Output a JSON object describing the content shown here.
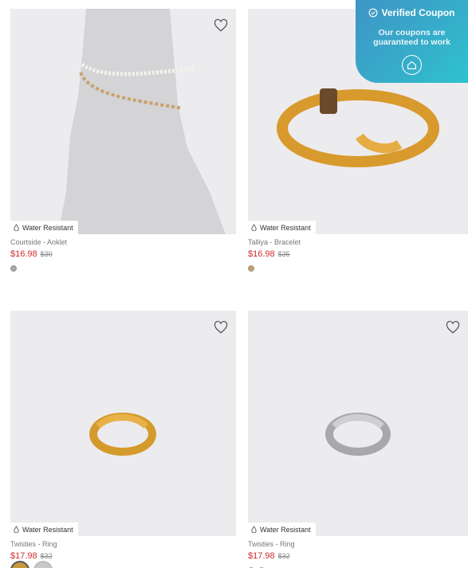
{
  "products": [
    {
      "badge": "Water Resistant",
      "title": "Courtside - Anklet",
      "price": "$16.98",
      "was": "$30",
      "swatches": [
        "#a6a6a6"
      ],
      "wishlist_icon": "heart-outline-icon"
    },
    {
      "badge": "Water Resistant",
      "title": "Talliya - Bracelet",
      "price": "$16.98",
      "was": "$35",
      "swatches": [
        "#c9a15a"
      ],
      "wishlist_icon": "heart-outline-icon"
    },
    {
      "badge": "Water Resistant",
      "title": "Twisties - Ring",
      "price": "$17.98",
      "was": "$32",
      "swatches": [
        "#c79a3e",
        "#c8c8c8"
      ],
      "wishlist_icon": "heart-outline-icon"
    },
    {
      "badge": "Water Resistant",
      "title": "Twisties - Ring",
      "price": "$17.98",
      "was": "$32",
      "swatches": [
        "#b9b9b9",
        "#c9a15a"
      ],
      "wishlist_icon": "heart-outline-icon"
    }
  ],
  "coupon": {
    "title": "Verified Coupon",
    "subtitle": "Our coupons are guaranteed to work",
    "accent": "#3aa6c8"
  }
}
